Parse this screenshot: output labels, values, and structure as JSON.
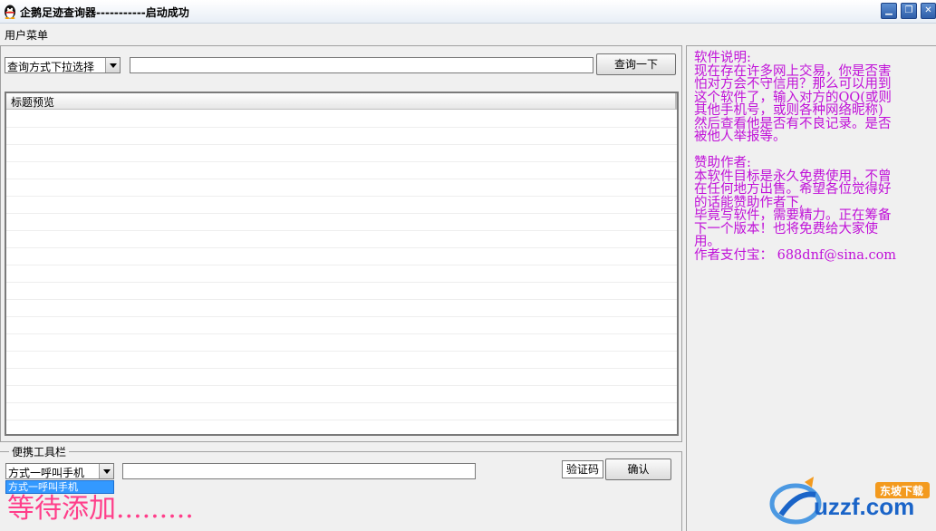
{
  "window": {
    "title": "企鹅足迹查询器-----------启动成功",
    "controls": {
      "minimize": "minimize-icon",
      "restore": "restore-icon",
      "close": "close-icon"
    },
    "accent_color": "#2f5ea9"
  },
  "menu": {
    "user_menu": "用户菜单"
  },
  "query": {
    "mode_select_value": "查询方式下拉选择",
    "input_value": "",
    "button_label": "查询一下"
  },
  "results": {
    "header_label": "标题预览",
    "rows": []
  },
  "toolbar": {
    "legend": "便携工具栏",
    "method_select_value": "方式一呼叫手机",
    "method_option_highlighted": "方式一呼叫手机",
    "input_value": "",
    "captcha_label": "验证码",
    "confirm_label": "确认",
    "waiting_text": "等待添加.........",
    "waiting_color": "#ff3e8a"
  },
  "info": {
    "text_color": "#c010d8",
    "about_heading": "软件说明:",
    "about_lines": [
      "现在存在许多网上交易，你是否害",
      "怕对方会不守信用？那么可以用到",
      "这个软件了，输入对方的QQ(或则",
      "其他手机号，或则各种网络昵称)",
      "然后查看他是否有不良记录。是否",
      "被他人举报等。"
    ],
    "sponsor_heading": "赞助作者:",
    "sponsor_lines": [
      "本软件目标是永久免费使用，不曾",
      "在任何地方出售。希望各位觉得好",
      "的话能赞助作者下,",
      "毕竟写软件，需要精力。正在筹备",
      "下一个版本！也将免费给大家使",
      "用。"
    ],
    "alipay_line": "作者支付宝： 688dnf@sina.com"
  },
  "watermark": {
    "logo": "uzzf-logo",
    "text": "uzzf.com",
    "badge": "东坡下载"
  }
}
